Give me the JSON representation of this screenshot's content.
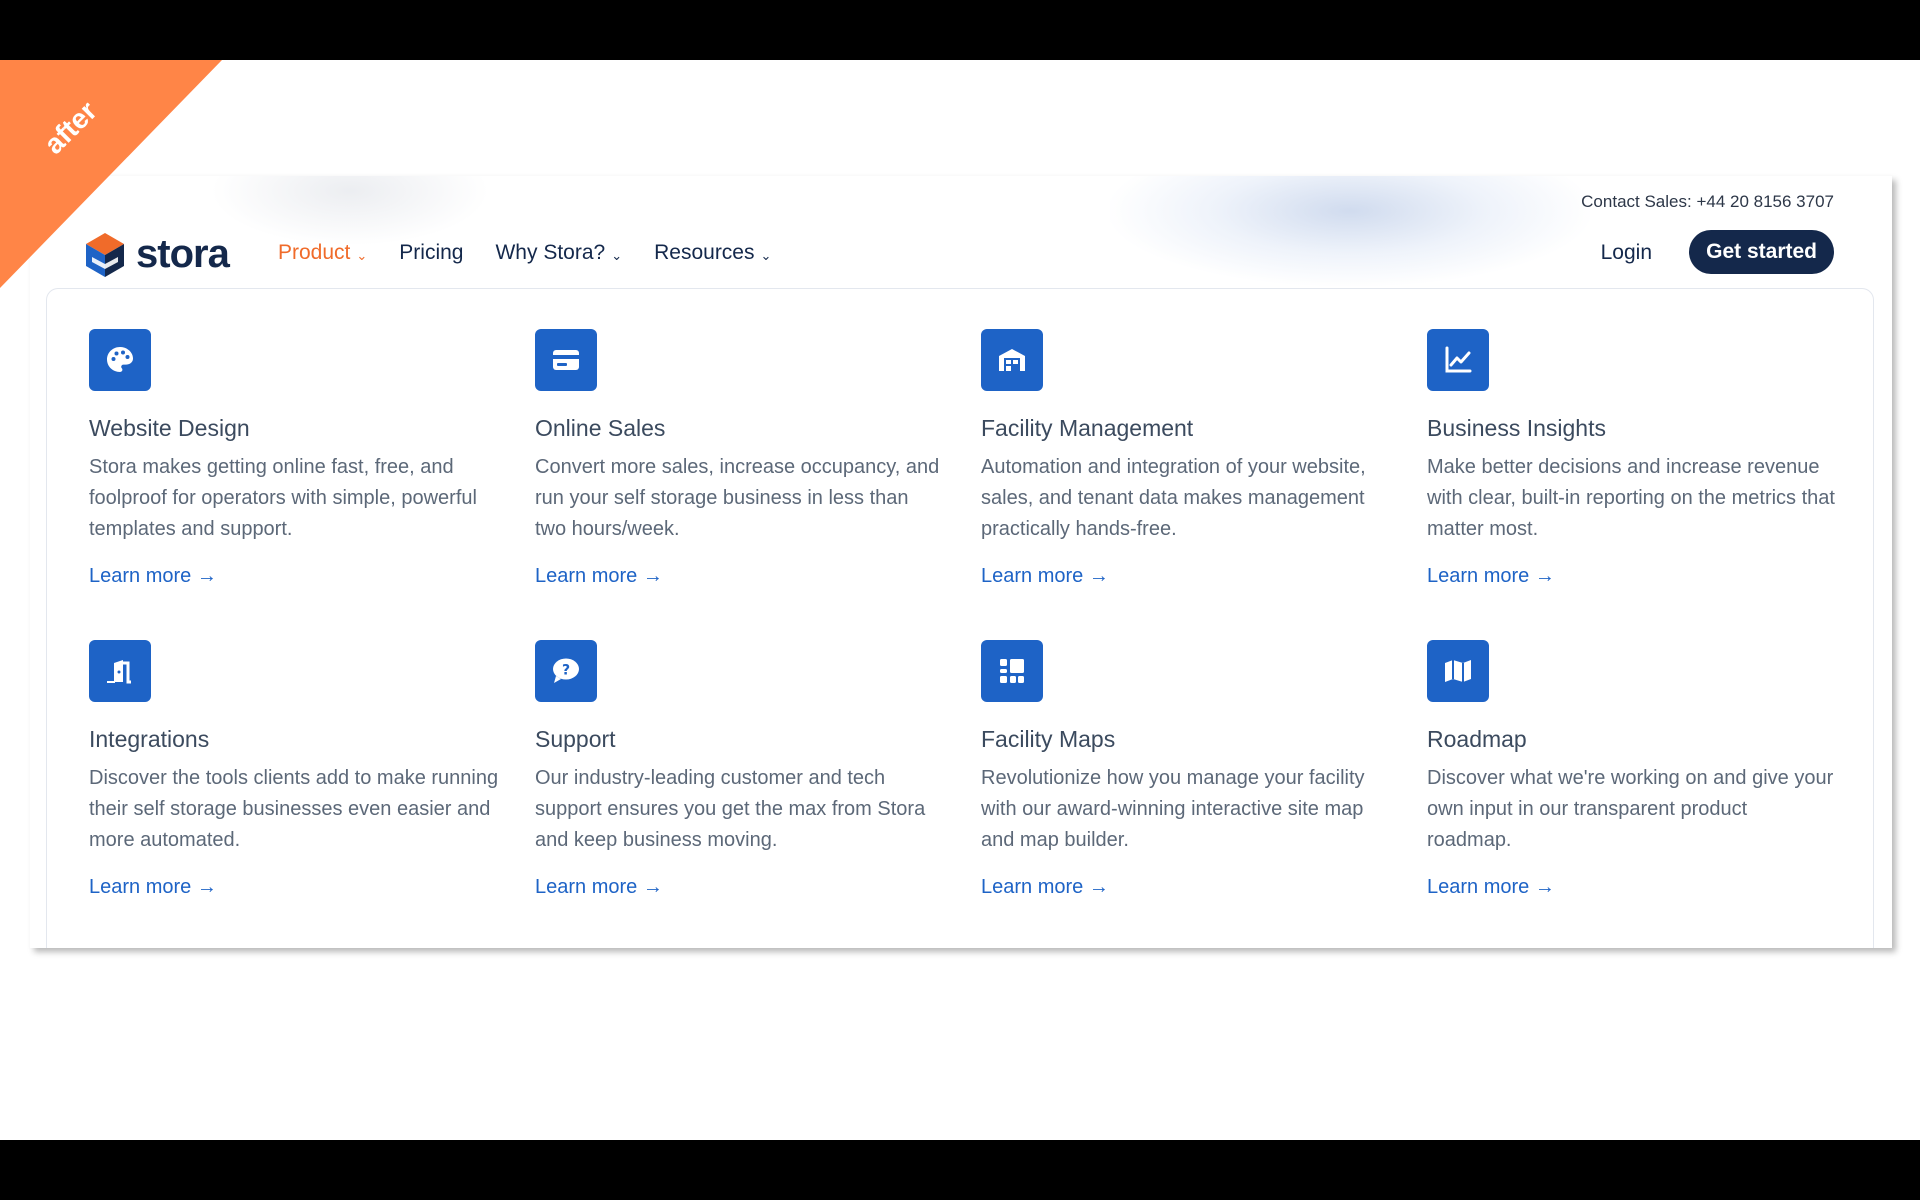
{
  "ribbon": {
    "label": "after"
  },
  "header": {
    "contact": "Contact Sales: +44 20 8156 3707",
    "brand": "stora",
    "nav": [
      {
        "label": "Product",
        "has_chevron": true,
        "active": true
      },
      {
        "label": "Pricing",
        "has_chevron": false,
        "active": false
      },
      {
        "label": "Why Stora?",
        "has_chevron": true,
        "active": false
      },
      {
        "label": "Resources",
        "has_chevron": true,
        "active": false
      }
    ],
    "chevron": "⌄",
    "login": "Login",
    "cta": "Get started"
  },
  "menu": {
    "items": [
      {
        "icon": "palette-icon",
        "title": "Website Design",
        "desc": "Stora makes getting online fast, free, and foolproof for operators with simple, powerful templates and support.",
        "link": "Learn more →"
      },
      {
        "icon": "credit-card-icon",
        "title": "Online Sales",
        "desc": "Convert more sales, increase occupancy, and run your self storage business in less than two hours/week.",
        "link": "Learn more →"
      },
      {
        "icon": "warehouse-icon",
        "title": "Facility Management",
        "desc": "Automation and integration of your website, sales, and tenant data makes management practically hands-free.",
        "link": "Learn more →"
      },
      {
        "icon": "line-chart-icon",
        "title": "Business Insights",
        "desc": "Make better decisions and increase revenue with clear, built-in reporting on the metrics that matter most.",
        "link": "Learn more →"
      },
      {
        "icon": "door-open-icon",
        "title": "Integrations",
        "desc": "Discover the tools clients add to make running their self storage businesses even easier and more automated.",
        "link": "Learn more →"
      },
      {
        "icon": "question-bubble-icon",
        "title": "Support",
        "desc": "Our industry-leading customer and tech support ensures you get the max from Stora and keep business moving.",
        "link": "Learn more →"
      },
      {
        "icon": "grid-layout-icon",
        "title": "Facility Maps",
        "desc": "Revolutionize how you manage your facility with our award-winning interactive site map and map builder.",
        "link": "Learn more →"
      },
      {
        "icon": "map-icon",
        "title": "Roadmap",
        "desc": "Discover what we're working on and give your own input in our transparent product roadmap.",
        "link": "Learn more →"
      }
    ]
  },
  "colors": {
    "brand_navy": "#14284b",
    "accent_orange": "#f06b2a",
    "icon_blue": "#1e63c6",
    "ribbon": "#ff8547"
  }
}
